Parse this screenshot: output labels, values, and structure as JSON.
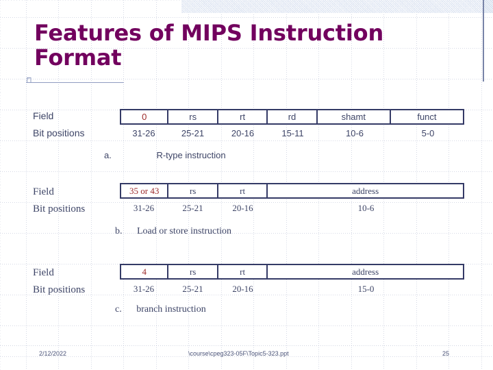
{
  "slide": {
    "title": "Features of MIPS Instruction Format",
    "accent_color": "#72005e",
    "table_border_color": "#343a66",
    "text_color": "#3d4466",
    "opcode_color": "#9d2b2b",
    "band_color": "#cfdaec"
  },
  "labels": {
    "field": "Field",
    "bit_positions": "Bit positions"
  },
  "tables": [
    {
      "id": "r-type",
      "font": "sans",
      "fields": [
        "0",
        "rs",
        "rt",
        "rd",
        "shamt",
        "funct"
      ],
      "bits": [
        "31-26",
        "25-21",
        "20-16",
        "15-11",
        "10-6",
        "5-0"
      ],
      "caption_letter": "a.",
      "caption_text": "R-type instruction"
    },
    {
      "id": "load-store",
      "font": "serif",
      "fields": [
        "35 or 43",
        "rs",
        "rt",
        "address"
      ],
      "bits": [
        "31-26",
        "25-21",
        "20-16",
        "10-6"
      ],
      "caption_letter": "b.",
      "caption_text": "Load or store instruction"
    },
    {
      "id": "branch",
      "font": "serif",
      "fields": [
        "4",
        "rs",
        "rt",
        "address"
      ],
      "bits": [
        "31-26",
        "25-21",
        "20-16",
        "15-0"
      ],
      "caption_letter": "c.",
      "caption_text": "branch instruction"
    }
  ],
  "footer": {
    "date": "2/12/2022",
    "path": "\\course\\cpeg323-05F\\Topic5-323.ppt",
    "page": "25"
  }
}
